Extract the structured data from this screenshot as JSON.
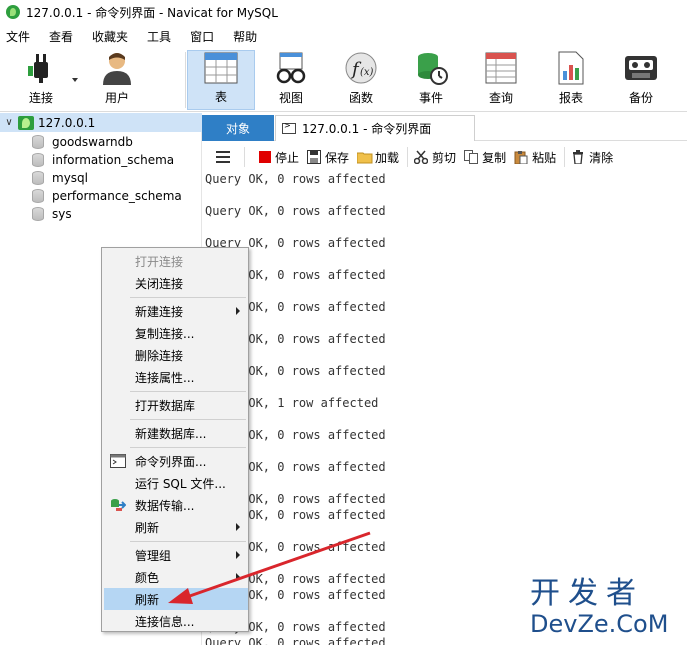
{
  "window": {
    "title": "127.0.0.1 - 命令列界面 - Navicat for MySQL"
  },
  "menubar": {
    "items": [
      "文件",
      "查看",
      "收藏夹",
      "工具",
      "窗口",
      "帮助"
    ]
  },
  "toolbar": {
    "buttons": [
      {
        "label": "连接",
        "icon": "plug-icon"
      },
      {
        "label": "用户",
        "icon": "user-icon"
      },
      {
        "label": "表",
        "icon": "table-icon",
        "active": true
      },
      {
        "label": "视图",
        "icon": "view-glasses-icon"
      },
      {
        "label": "函数",
        "icon": "function-icon"
      },
      {
        "label": "事件",
        "icon": "event-clock-icon"
      },
      {
        "label": "查询",
        "icon": "query-icon"
      },
      {
        "label": "报表",
        "icon": "report-icon"
      },
      {
        "label": "备份",
        "icon": "backup-icon"
      }
    ]
  },
  "sidebar": {
    "connection": "127.0.0.1",
    "databases": [
      "goodswarndb",
      "information_schema",
      "mysql",
      "performance_schema",
      "sys"
    ]
  },
  "tabs": {
    "objects": "对象",
    "command": "127.0.0.1 - 命令列界面"
  },
  "commandbar": {
    "stop": "停止",
    "save": "保存",
    "load": "加载",
    "cut": "剪切",
    "copy": "复制",
    "paste": "粘贴",
    "clear": "清除"
  },
  "console": {
    "lines": [
      "Query OK, 0 rows affected",
      "Query OK, 0 rows affected",
      "Query OK, 0 rows affected",
      "Query OK, 0 rows affected",
      "Query OK, 0 rows affected",
      "Query OK, 0 rows affected",
      "Query OK, 0 rows affected",
      "Query OK, 1 row affected",
      "Query OK, 0 rows affected",
      "Query OK, 0 rows affected",
      "Query OK, 0 rows affected",
      "Query OK, 0 rows affected",
      "Query OK, 0 rows affected",
      "Query OK, 0 rows affected",
      "Query OK, 0 rows affected",
      "Query OK, 0 rows affected",
      "Query OK, 0 rows affected"
    ]
  },
  "context_menu": {
    "items": [
      {
        "label": "打开连接",
        "disabled": true
      },
      {
        "label": "关闭连接"
      },
      {
        "label": "新建连接",
        "submenu": true
      },
      {
        "label": "复制连接..."
      },
      {
        "label": "删除连接"
      },
      {
        "label": "连接属性..."
      },
      {
        "label": "打开数据库"
      },
      {
        "label": "新建数据库..."
      },
      {
        "label": "命令列界面...",
        "icon": "terminal-icon"
      },
      {
        "label": "运行 SQL 文件..."
      },
      {
        "label": "数据传输...",
        "icon": "data-transfer-icon"
      },
      {
        "label": "刷新",
        "submenu": true
      },
      {
        "label": "管理组",
        "submenu": true
      },
      {
        "label": "颜色",
        "submenu": true
      },
      {
        "label": "刷新",
        "highlighted": true
      },
      {
        "label": "连接信息..."
      }
    ]
  },
  "watermark": {
    "line1": "开发者",
    "line2": "DevZe.CoM"
  },
  "colors": {
    "accent": "#2f7fc6",
    "selection": "#cfe3f7",
    "annotation_arrow": "#d9262c"
  }
}
